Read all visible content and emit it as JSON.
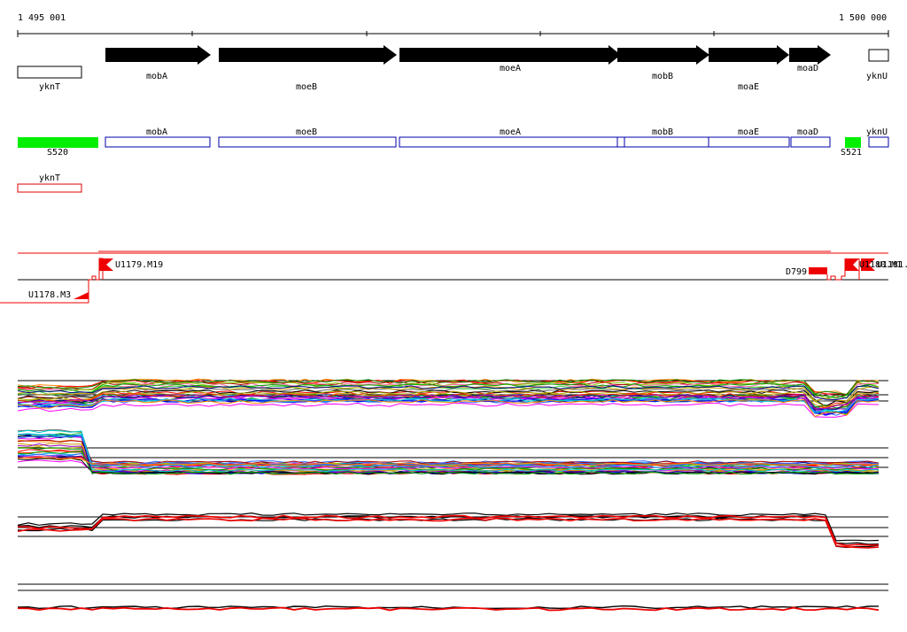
{
  "coords": {
    "start_label": "1 495 001",
    "end_label": "1 500 000"
  },
  "genes": [
    {
      "label": "yknT",
      "kind": "box"
    },
    {
      "label": "mobA",
      "kind": "arrow"
    },
    {
      "label": "moeB",
      "kind": "arrow"
    },
    {
      "label": "moeA",
      "kind": "arrow"
    },
    {
      "label": "mobB",
      "kind": "arrow"
    },
    {
      "label": "moaE",
      "kind": "arrow"
    },
    {
      "label": "moaD",
      "kind": "arrow"
    },
    {
      "label": "yknU",
      "kind": "box"
    }
  ],
  "regions": [
    {
      "label": "S520",
      "color": "#00ee00"
    },
    {
      "label": "mobA",
      "color": "#0000aa"
    },
    {
      "label": "moeB",
      "color": "#0000aa"
    },
    {
      "label": "moeA",
      "color": "#0000aa"
    },
    {
      "label": "mobB",
      "color": "#0000aa"
    },
    {
      "label": "moaE",
      "color": "#0000aa"
    },
    {
      "label": "moaD",
      "color": "#0000aa"
    },
    {
      "label": "S521",
      "color": "#00ee00"
    },
    {
      "label": "yknU",
      "color": "#0000aa"
    }
  ],
  "lower_gene": {
    "label": "yknT",
    "color": "#dd0000"
  },
  "features": [
    {
      "label": "U1179.M19"
    },
    {
      "label": "U1178.M3"
    },
    {
      "label": "D799"
    },
    {
      "label": "U1180.M1"
    },
    {
      "label": "U1181."
    }
  ],
  "colors": {
    "gene_fill": "#000000",
    "region_outline": "#0000aa",
    "feature_red": "#ee0000",
    "green": "#00ee00"
  }
}
